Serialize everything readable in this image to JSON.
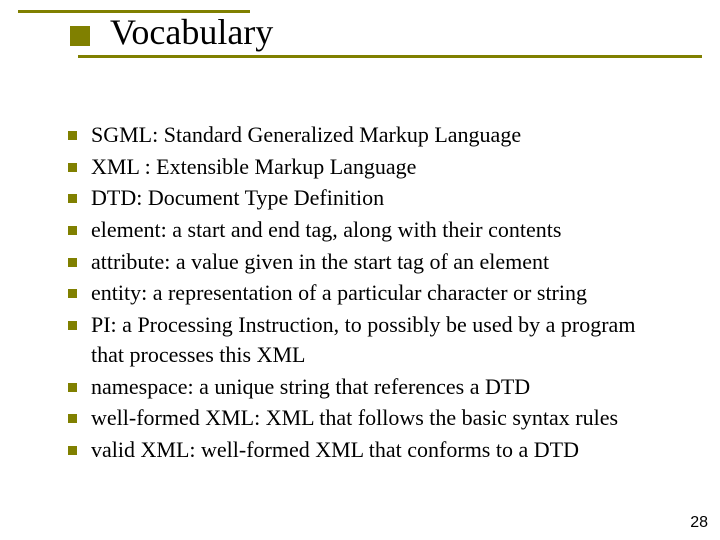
{
  "title": "Vocabulary",
  "page_number": "28",
  "accent_color": "#808000",
  "bullets": [
    {
      "term": "SGML",
      "sep": ": ",
      "def": "Standard Generalized Markup Language"
    },
    {
      "term": "XML",
      "sep": " : ",
      "def": "Extensible Markup Language"
    },
    {
      "term": "DTD",
      "sep": ": ",
      "def": "Document Type Definition"
    },
    {
      "term": "element",
      "sep": ": ",
      "def": "a start and end tag, along with their contents"
    },
    {
      "term": "attribute",
      "sep": ": ",
      "def": "a value given in the start tag of an element"
    },
    {
      "term": "entity",
      "sep": ": ",
      "def": "a representation of a particular character or string"
    },
    {
      "term": "PI",
      "sep": ": ",
      "def": "a Processing Instruction, to possibly be used by a program that processes this XML"
    },
    {
      "term": "namespace",
      "sep": ": ",
      "def": "a unique string that references a DTD"
    },
    {
      "term": "well-formed XML",
      "sep": ": ",
      "def": "XML that follows the basic syntax rules"
    },
    {
      "term": "valid XML",
      "sep": ": ",
      "def": "well-formed XML that conforms to a  DTD"
    }
  ]
}
